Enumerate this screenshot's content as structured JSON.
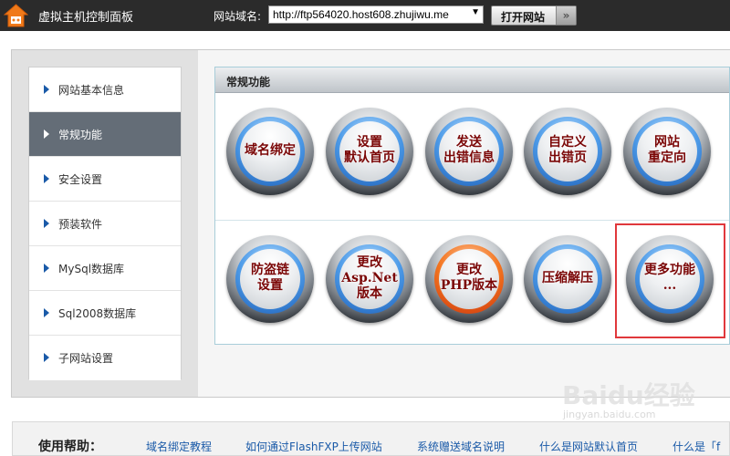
{
  "header": {
    "app_title": "虚拟主机控制面板",
    "domain_label": "网站域名:",
    "domain_value": "http://ftp564020.host608.zhujiwu.me",
    "open_button": "打开网站",
    "icons": {
      "logo": "home-logo-icon",
      "dropdown": "dropdown-arrow-icon",
      "open": "double-chevron-right-icon"
    }
  },
  "sidebar": {
    "items": [
      {
        "label": "网站基本信息",
        "active": false
      },
      {
        "label": "常规功能",
        "active": true
      },
      {
        "label": "安全设置",
        "active": false
      },
      {
        "label": "预装软件",
        "active": false
      },
      {
        "label": "MySql数据库",
        "active": false
      },
      {
        "label": "Sql2008数据库",
        "active": false
      },
      {
        "label": "子网站设置",
        "active": false
      }
    ]
  },
  "panel": {
    "title": "常规功能",
    "buttons": [
      {
        "lines": [
          "域名绑定"
        ]
      },
      {
        "lines": [
          "设置",
          "默认首页"
        ]
      },
      {
        "lines": [
          "发送",
          "出错信息"
        ]
      },
      {
        "lines": [
          "自定义",
          "出错页"
        ]
      },
      {
        "lines": [
          "网站",
          "重定向"
        ]
      },
      {
        "lines": [
          "防盗链",
          "设置"
        ]
      },
      {
        "lines": [
          "更改",
          "Asp.Net",
          "版本"
        ]
      },
      {
        "lines": [
          "更改",
          "PHP版本"
        ]
      },
      {
        "lines": [
          "压缩解压"
        ]
      },
      {
        "lines": [
          "更多功能",
          "..."
        ]
      }
    ]
  },
  "help": {
    "title": "使用帮助：",
    "links": [
      "域名绑定教程",
      "如何通过FlashFXP上传网站",
      "系统赠送域名说明",
      "什么是网站默认首页",
      "什么是「f"
    ]
  },
  "watermark": {
    "text": "Baidu经验",
    "sub": "jingyan.baidu.com"
  },
  "colors": {
    "topbar": "#2b2b2b",
    "active_sidebar": "#646d77",
    "button_ring": "#1b5cb5",
    "button_ring_alt": "#f3751f",
    "button_text": "#7a0606",
    "highlight": "#e0383c",
    "link": "#1a5aa8"
  }
}
